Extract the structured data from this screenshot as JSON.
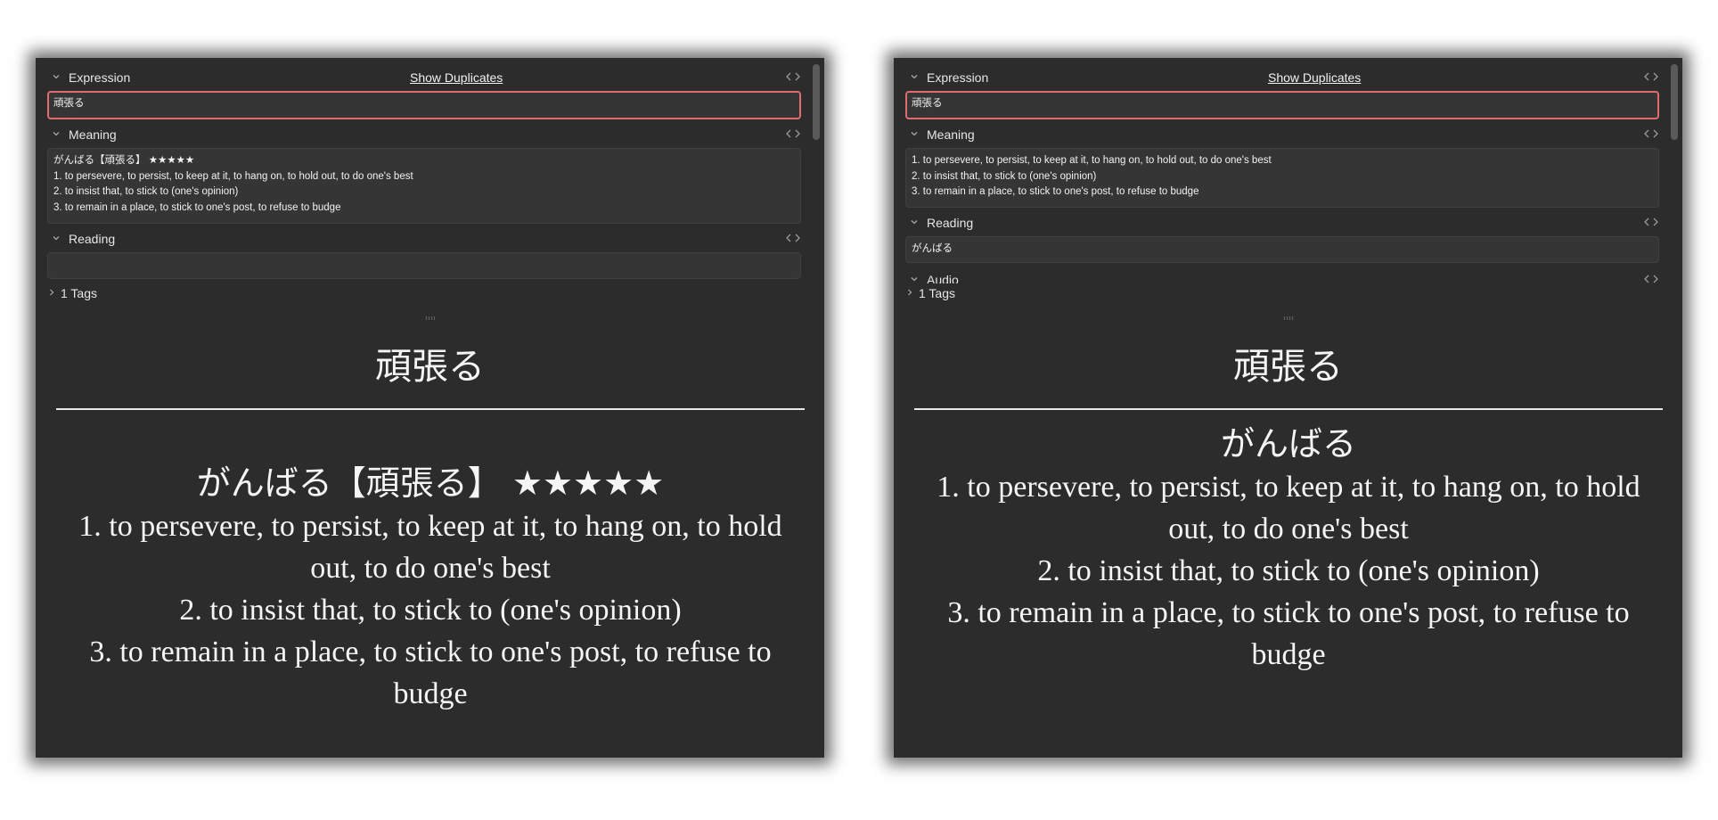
{
  "panels": [
    {
      "fields": {
        "expression": {
          "label": "Expression",
          "value": "頑張る",
          "show_duplicates": "Show Duplicates",
          "html_toggle": "‹›"
        },
        "meaning": {
          "label": "Meaning",
          "html_toggle": "‹›",
          "lines": [
            "がんばる【頑張る】 ★★★★★",
            "1. to persevere, to persist, to keep at it, to hang on, to hold out, to do one's best",
            "2. to insist that, to stick to (one's opinion)",
            "3. to remain in a place, to stick to one's post, to refuse to budge"
          ]
        },
        "reading": {
          "label": "Reading",
          "html_toggle": "‹›",
          "value": ""
        }
      },
      "tags_label": "1 Tags",
      "preview": {
        "front": "頑張る",
        "back_heading": "がんばる【頑張る】 ★★★★★",
        "back_lines": [
          "1. to persevere, to persist, to keep at it, to hang on, to hold out, to do one's best",
          "2. to insist that, to stick to (one's opinion)",
          "3. to remain in a place, to stick to one's post, to refuse to budge"
        ]
      }
    },
    {
      "fields": {
        "expression": {
          "label": "Expression",
          "value": "頑張る",
          "show_duplicates": "Show Duplicates",
          "html_toggle": "‹›"
        },
        "meaning": {
          "label": "Meaning",
          "html_toggle": "‹›",
          "lines": [
            "1. to persevere, to persist, to keep at it, to hang on, to hold out, to do one's best",
            "2. to insist that, to stick to (one's opinion)",
            "3. to remain in a place, to stick to one's post, to refuse to budge"
          ]
        },
        "reading": {
          "label": "Reading",
          "html_toggle": "‹›",
          "value": "がんばる"
        },
        "audio": {
          "label": "Audio",
          "html_toggle": "‹›"
        }
      },
      "tags_label": "1 Tags",
      "preview": {
        "front": "頑張る",
        "back_heading": "がんばる",
        "back_lines": [
          "1. to persevere, to persist, to keep at it, to hang on, to hold out, to do one's best",
          "2. to insist that, to stick to (one's opinion)",
          "3. to remain in a place, to stick to one's post, to refuse to budge"
        ]
      }
    }
  ],
  "colors": {
    "panel_bg": "#2c2c2c",
    "field_bg": "#353535",
    "focus_border": "#e06c6c",
    "text": "#f2f2f2"
  }
}
